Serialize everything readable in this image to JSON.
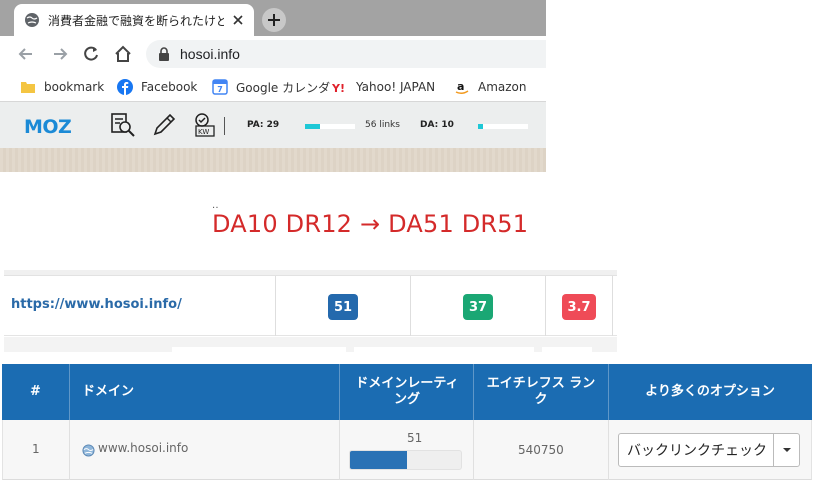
{
  "browser": {
    "tab_title": "消費者金融で融資を断られたけど、ヽ",
    "url": "hosoi.info",
    "bookmarks": [
      {
        "label": "bookmark",
        "icon": "folder-icon"
      },
      {
        "label": "Facebook",
        "icon": "facebook-icon"
      },
      {
        "label": "Google カレンダ",
        "icon": "google-calendar-icon"
      },
      {
        "label": "Yahoo! JAPAN",
        "icon": "yahoo-icon"
      },
      {
        "label": "Amazon",
        "icon": "amazon-icon"
      }
    ]
  },
  "mozbar": {
    "logo": "MOZ",
    "pa_label": "PA: 29",
    "pa_bar_fraction": 0.29,
    "links": "56 links",
    "da_label": "DA: 10",
    "da_bar_fraction": 0.1,
    "accent": "#1ec8d6"
  },
  "headline": {
    "dots": "..",
    "text": "DA10 DR12 → DA51 DR51",
    "color": "#d42a2a"
  },
  "metrics": {
    "site": "https://www.hosoi.info/",
    "badges": [
      {
        "value": "51",
        "color": "#2469ad"
      },
      {
        "value": "37",
        "color": "#1aa774"
      },
      {
        "value": "3.7",
        "color": "#ef4b57"
      }
    ]
  },
  "table": {
    "header_color": "#1b6cb2",
    "headers": [
      "#",
      "ドメイン",
      "ドメインレーティング",
      "エイチレフス ランク",
      "より多くのオプション"
    ],
    "rows": [
      {
        "index": "1",
        "domain": "www.hosoi.info",
        "domain_rating": "51",
        "domain_rating_fraction": 0.51,
        "ahrefs_rank": "540750",
        "option": "バックリンクチェック"
      }
    ]
  }
}
